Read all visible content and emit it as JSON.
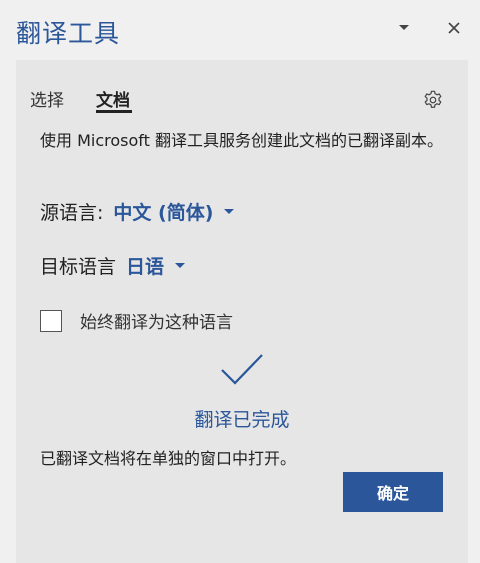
{
  "header": {
    "title": "翻译工具",
    "collapse_icon": "chevron-down-icon",
    "close_icon": "close-icon"
  },
  "tabs": [
    {
      "label": "选择",
      "selected": false
    },
    {
      "label": "文档",
      "selected": true
    }
  ],
  "settings_icon": "gear-icon",
  "description": "使用 Microsoft 翻译工具服务创建此文档的已翻译副本。",
  "source": {
    "label": "源语言:",
    "value": "中文 (简体)"
  },
  "target": {
    "label": "目标语言",
    "value": "日语"
  },
  "always_translate": {
    "label": "始终翻译为这种语言",
    "checked": false
  },
  "status": {
    "icon": "checkmark-icon",
    "text": "翻译已完成",
    "detail": "已翻译文档将在单独的窗口中打开。"
  },
  "ok_button": "确定",
  "colors": {
    "accent": "#2b579a",
    "pane_bg": "#e6e6e6",
    "window_bg": "#f0f0f0"
  }
}
